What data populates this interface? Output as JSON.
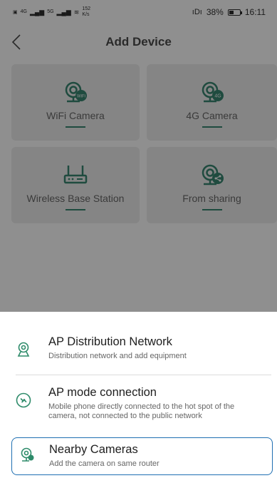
{
  "status_bar": {
    "signal_left": "4G",
    "signal_right": "5G",
    "speed_value": "152",
    "speed_unit": "K/s",
    "vibrate_indicator": "ıDı",
    "battery_percent": "38%",
    "battery_level": 0.38,
    "time": "16:11"
  },
  "header": {
    "title": "Add Device",
    "back_icon": "chevron-left-icon"
  },
  "tiles": [
    {
      "label": "WiFi Camera",
      "icon": "wifi-camera-icon"
    },
    {
      "label": "4G Camera",
      "icon": "4g-camera-icon"
    },
    {
      "label": "Wireless Base Station",
      "icon": "base-station-icon"
    },
    {
      "label": "From sharing",
      "icon": "share-camera-icon"
    }
  ],
  "icon_badges": {
    "wifi": "WiFi",
    "fourg": "4G"
  },
  "options": [
    {
      "title": "AP Distribution Network",
      "desc": "Distribution network and add equipment",
      "icon": "ap-network-icon"
    },
    {
      "title": "AP mode connection",
      "desc": "Mobile phone directly connected to the hot spot of the camera, not connected to the public network",
      "icon": "link-icon"
    },
    {
      "title": "Nearby Cameras",
      "desc": "Add the camera on same router",
      "icon": "nearby-camera-icon",
      "selected": true
    }
  ],
  "colors": {
    "accent_green": "#1f4b3f",
    "icon_green": "#2e8b6a",
    "selected_border": "#1f6fb2",
    "overlay": "#8f8f8f"
  }
}
